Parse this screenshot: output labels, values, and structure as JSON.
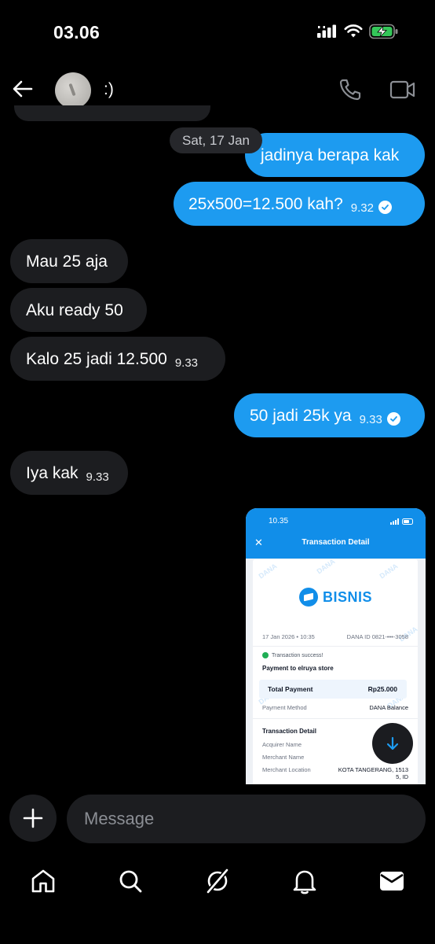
{
  "status_bar": {
    "time": "03.06"
  },
  "header": {
    "contact_name": ":)"
  },
  "date_chip": "Sat, 17 Jan",
  "messages": [
    {
      "dir": "out",
      "text": "jadinya berapa kak",
      "time": "",
      "read": false
    },
    {
      "dir": "out",
      "text": "25x500=12.500 kah?",
      "time": "9.32",
      "read": true
    },
    {
      "dir": "in",
      "text": "Mau 25 aja",
      "time": ""
    },
    {
      "dir": "in",
      "text": "Aku ready 50",
      "time": ""
    },
    {
      "dir": "in",
      "text": "Kalo 25 jadi 12.500",
      "time": "9.33"
    },
    {
      "dir": "out",
      "text": "50 jadi 25k ya",
      "time": "9.33",
      "read": true
    },
    {
      "dir": "in",
      "text": "Iya kak",
      "time": "9.33"
    }
  ],
  "attachment": {
    "status_time": "10.35",
    "title": "Transaction Detail",
    "brand": "BISNIS",
    "watermark": "DANA",
    "date": "17 Jan 2026 • 10:35",
    "dana_id": "DANA ID 0821-•••-3058",
    "success_text": "Transaction success!",
    "payment_to": "Payment to elruya store",
    "total_label": "Total Payment",
    "total_value": "Rp25.000",
    "method_label": "Payment Method",
    "method_value": "DANA Balance",
    "section_title": "Transaction Detail",
    "acquirer_label": "Acquirer Name",
    "merchant_label": "Merchant Name",
    "location_label": "Merchant Location",
    "location_value_1": "KOTA TANGERANG, 1513",
    "location_value_2": "5, ID"
  },
  "composer": {
    "placeholder": "Message"
  },
  "nav": {
    "items": [
      "home-icon",
      "search-icon",
      "grok-icon",
      "notifications-icon",
      "messages-icon"
    ]
  },
  "colors": {
    "outgoing": "#1d9bf0",
    "incoming": "#1c1d20",
    "background": "#000000",
    "dana_blue": "#118ee9"
  }
}
